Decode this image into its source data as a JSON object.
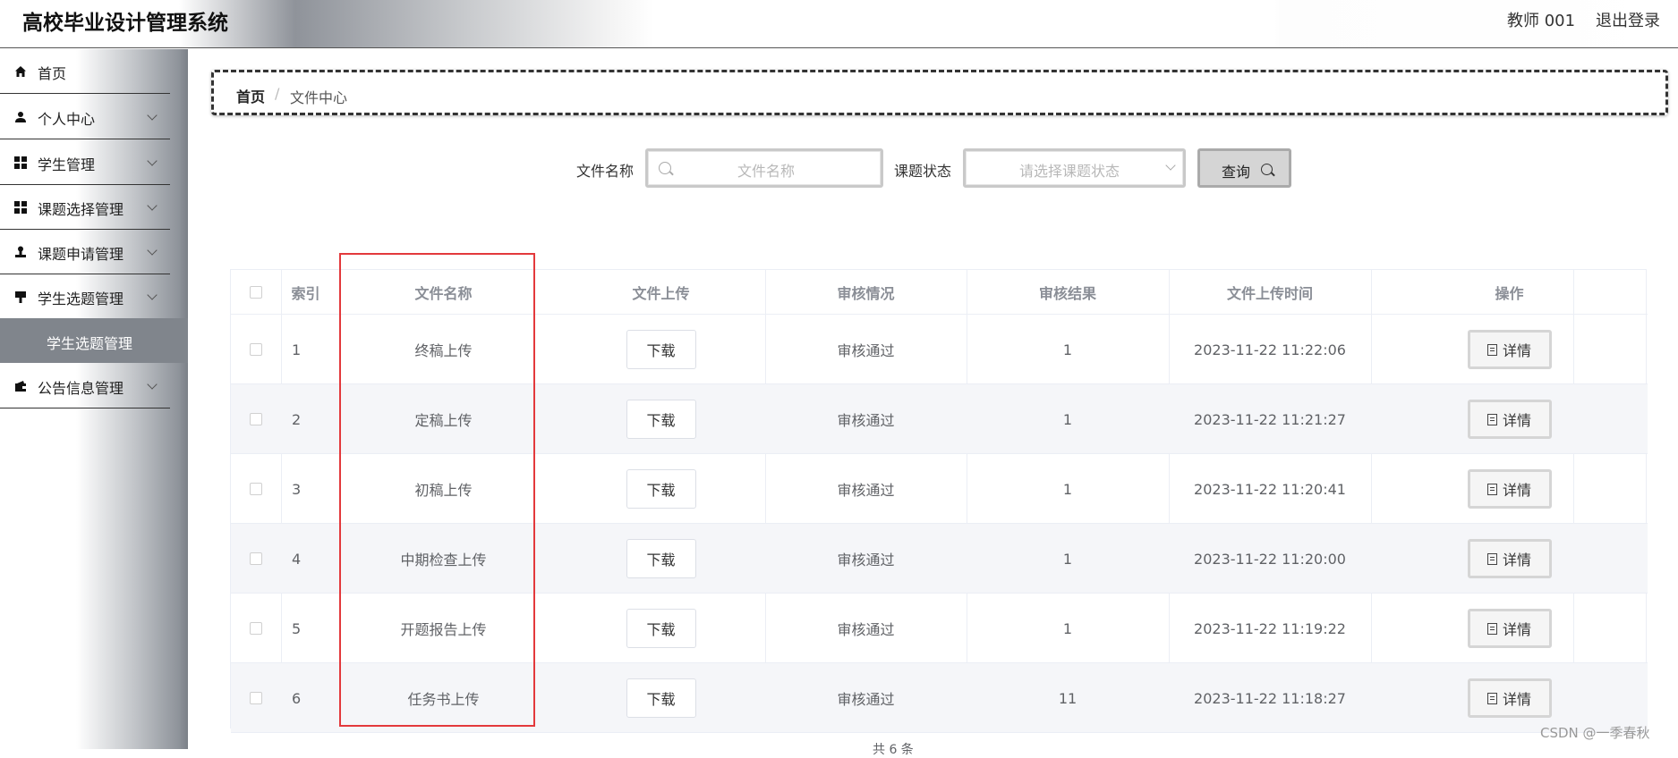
{
  "header": {
    "title": "高校毕业设计管理系统",
    "user": "教师 001",
    "logout": "退出登录"
  },
  "sidebar": {
    "items": [
      {
        "label": "首页"
      },
      {
        "label": "个人中心"
      },
      {
        "label": "学生管理"
      },
      {
        "label": "课题选择管理"
      },
      {
        "label": "课题申请管理"
      },
      {
        "label": "学生选题管理"
      },
      {
        "label": "公告信息管理"
      }
    ],
    "subitem": "学生选题管理"
  },
  "breadcrumb": {
    "home": "首页",
    "separator": "/",
    "current": "文件中心"
  },
  "search": {
    "file_name_label": "文件名称",
    "file_name_placeholder": "文件名称",
    "status_label": "课题状态",
    "status_placeholder": "请选择课题状态",
    "query_label": "查询"
  },
  "table": {
    "headers": [
      "索引",
      "文件名称",
      "文件上传",
      "审核情况",
      "审核结果",
      "文件上传时间",
      "操作"
    ],
    "download_label": "下载",
    "detail_label": "详情",
    "rows": [
      {
        "index": "1",
        "name": "终稿上传",
        "review": "审核通过",
        "result": "1",
        "time": "2023-11-22 11:22:06"
      },
      {
        "index": "2",
        "name": "定稿上传",
        "review": "审核通过",
        "result": "1",
        "time": "2023-11-22 11:21:27"
      },
      {
        "index": "3",
        "name": "初稿上传",
        "review": "审核通过",
        "result": "1",
        "time": "2023-11-22 11:20:41"
      },
      {
        "index": "4",
        "name": "中期检查上传",
        "review": "审核通过",
        "result": "1",
        "time": "2023-11-22 11:20:00"
      },
      {
        "index": "5",
        "name": "开题报告上传",
        "review": "审核通过",
        "result": "1",
        "time": "2023-11-22 11:19:22"
      },
      {
        "index": "6",
        "name": "任务书上传",
        "review": "审核通过",
        "result": "11",
        "time": "2023-11-22 11:18:27"
      }
    ]
  },
  "pager": {
    "total": "共 6 条"
  },
  "watermark": "CSDN @一季春秋",
  "colors": {
    "highlight": "#e3393c",
    "active_menu": "#80858c"
  }
}
